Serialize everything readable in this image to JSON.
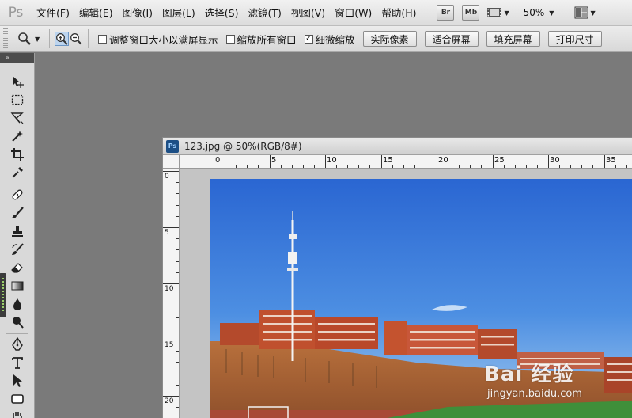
{
  "app": {
    "logo_text": "Ps"
  },
  "menu": {
    "items": [
      {
        "id": "file",
        "label": "文件(F)"
      },
      {
        "id": "edit",
        "label": "编辑(E)"
      },
      {
        "id": "image",
        "label": "图像(I)"
      },
      {
        "id": "layer",
        "label": "图层(L)"
      },
      {
        "id": "select",
        "label": "选择(S)"
      },
      {
        "id": "filter",
        "label": "滤镜(T)"
      },
      {
        "id": "view",
        "label": "视图(V)"
      },
      {
        "id": "window",
        "label": "窗口(W)"
      },
      {
        "id": "help",
        "label": "帮助(H)"
      }
    ],
    "bridge_label": "Br",
    "minibridge_label": "Mb",
    "zoom_value": "50%"
  },
  "options_bar": {
    "resize_windows_label": "调整窗口大小以满屏显示",
    "resize_windows_checked": false,
    "zoom_all_windows_label": "缩放所有窗口",
    "zoom_all_windows_checked": false,
    "scrubby_zoom_label": "细微缩放",
    "scrubby_zoom_checked": true,
    "actual_pixels_label": "实际像素",
    "fit_screen_label": "适合屏幕",
    "fill_screen_label": "填充屏幕",
    "print_size_label": "打印尺寸"
  },
  "toolbox": {
    "header_text": "»"
  },
  "document": {
    "title": "123.jpg @ 50%(RGB/8#)",
    "icon_text": "Ps",
    "ruler_h_labels": [
      "0",
      "5",
      "10",
      "15",
      "20",
      "25",
      "30",
      "35"
    ],
    "ruler_v_labels": [
      "0",
      "5",
      "10",
      "15",
      "20"
    ]
  },
  "watermark": {
    "logo_text": "Bai 经验",
    "url": "jingyan.baidu.com"
  },
  "colors": {
    "sky_top": "#2f6fd6",
    "sky_bottom": "#8fc0ee",
    "building": "#c0502e",
    "field": "#3f8f3a"
  }
}
